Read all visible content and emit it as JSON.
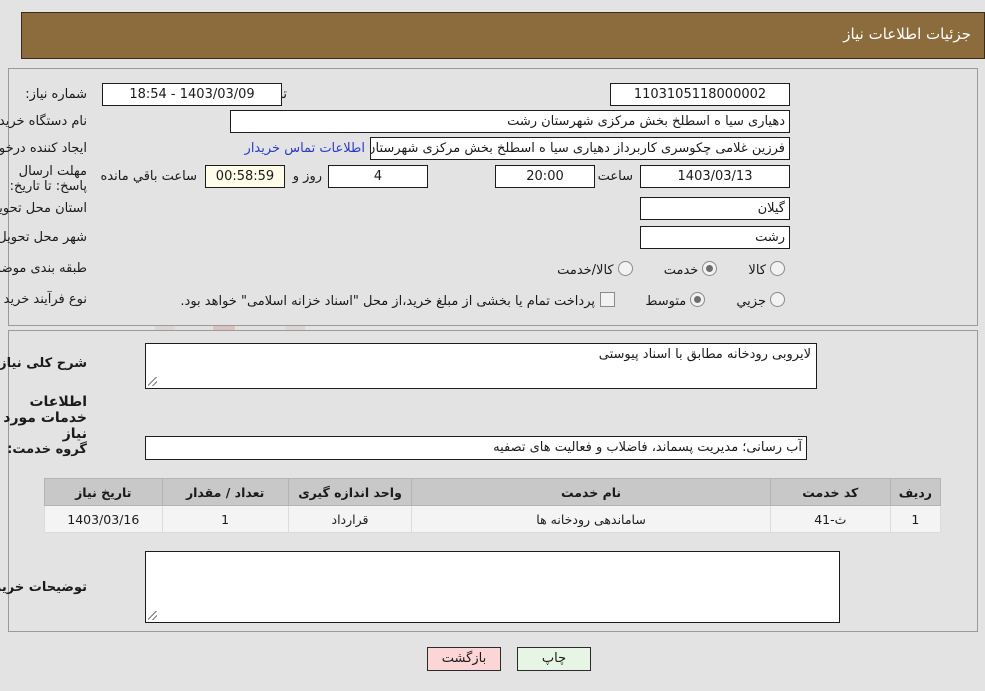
{
  "header": {
    "title": "جزئیات اطلاعات نیاز"
  },
  "form": {
    "need_number_label": "شماره نیاز:",
    "need_number_value": "1103105118000002",
    "public_announce_label": "تاریخ و ساعت اعلان عمومی:",
    "public_announce_value": "1403/03/09 - 18:54",
    "buyer_org_label": "نام دستگاه خریدار:",
    "buyer_org_value": "دهیاری سیا ه اسطلخ بخش مرکزی شهرستان رشت",
    "creator_label": "ایجاد کننده درخواست:",
    "creator_value": "فرزین غلامی چکوسری کاربرداز دهیاری سیا ه اسطلخ بخش مرکزی شهرستان ر",
    "contact_link": "اطلاعات تماس خریدار",
    "deadline_label": "مهلت ارسال پاسخ: تا تاریخ:",
    "deadline_date": "1403/03/13",
    "deadline_hour_label": "ساعت",
    "deadline_hour": "20:00",
    "days_value": "4",
    "days_label": "روز و",
    "countdown": "00:58:59",
    "countdown_label": "ساعت باقي مانده",
    "province_label": "استان محل تحویل:",
    "province_value": "گیلان",
    "city_label": "شهر محل تحویل:",
    "city_value": "رشت",
    "category_label": "طبقه بندی موضوعی:",
    "category_options": [
      {
        "label": "کالا",
        "selected": false
      },
      {
        "label": "خدمت",
        "selected": true
      },
      {
        "label": "کالا/خدمت",
        "selected": false
      }
    ],
    "process_label": "نوع فرآیند خرید :",
    "process_options": [
      {
        "label": "جزیي",
        "selected": false
      },
      {
        "label": "متوسط",
        "selected": true
      }
    ],
    "treasury_checkbox_label": "پرداخت تمام یا بخشی از مبلغ خرید،از محل \"اسناد خزانه اسلامی\" خواهد بود.",
    "treasury_checked": false
  },
  "description": {
    "need_summary_label": "شرح کلی نیاز:",
    "need_summary_value": "لایروبی رودخانه مطابق با اسناد پیوستی",
    "services_section_title": "اطلاعات خدمات مورد نیاز",
    "service_group_label": "گروه خدمت:",
    "service_group_value": "آب رسانی؛ مدیریت پسماند، فاضلاب و فعالیت های تصفیه",
    "buyer_notes_label": "توضیحات خریدار;",
    "buyer_notes_value": ""
  },
  "table": {
    "columns": [
      "ردیف",
      "کد خدمت",
      "نام خدمت",
      "واحد اندازه گیری",
      "تعداد / مقدار",
      "تاریخ نیاز"
    ],
    "rows": [
      {
        "row": "1",
        "code": "ث-41",
        "name": "ساماندهی رودخانه ها",
        "unit": "قرارداد",
        "quantity": "1",
        "need_date": "1403/03/16"
      }
    ]
  },
  "buttons": {
    "print": "چاپ",
    "back": "بازگشت"
  },
  "watermark": {
    "text": "AnaTender.net"
  },
  "colors": {
    "header_bar": "#8c6b3d",
    "page_bg": "#e3e3e3",
    "link": "#2b39c8",
    "print_btn": "#e7f6e4",
    "back_btn": "#fcd6d6",
    "countdown_bg": "#fffde9"
  }
}
